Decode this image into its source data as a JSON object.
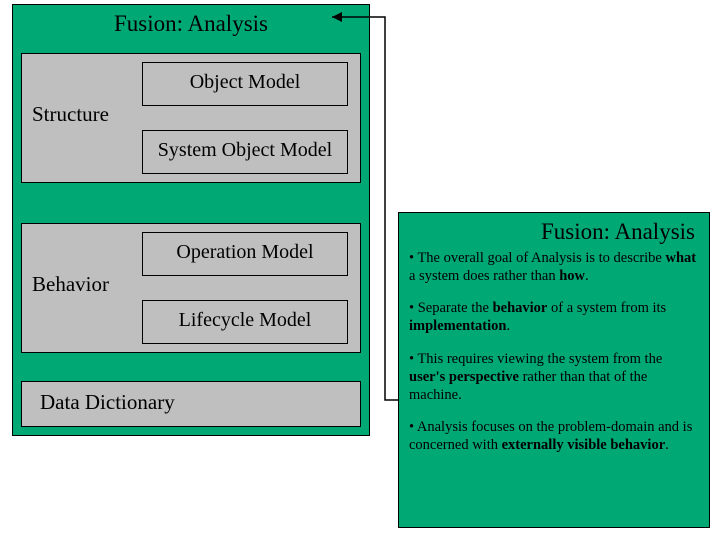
{
  "left": {
    "title": "Fusion: Analysis",
    "structure": {
      "label": "Structure",
      "object_model": "Object Model",
      "system_object_model": "System Object Model"
    },
    "behavior": {
      "label": "Behavior",
      "operation_model": "Operation Model",
      "lifecycle_model": "Lifecycle Model"
    },
    "data_dictionary": "Data Dictionary"
  },
  "right": {
    "title": "Fusion: Analysis",
    "b1_pre": "• The overall goal of Analysis is to describe ",
    "b1_bold1": "what",
    "b1_mid": " a system does rather than ",
    "b1_bold2": "how",
    "b1_post": ".",
    "b2_pre": "• Separate the ",
    "b2_bold1": "behavior",
    "b2_mid": " of a system from its ",
    "b2_bold2": "implementation",
    "b2_post": ".",
    "b3_pre": "• This requires viewing the system from the ",
    "b3_bold1": "user's perspective",
    "b3_post": " rather than that of the machine.",
    "b4_pre": "• Analysis focuses on the problem-domain and is concerned with ",
    "b4_bold1": "externally visible behavior",
    "b4_post": "."
  }
}
